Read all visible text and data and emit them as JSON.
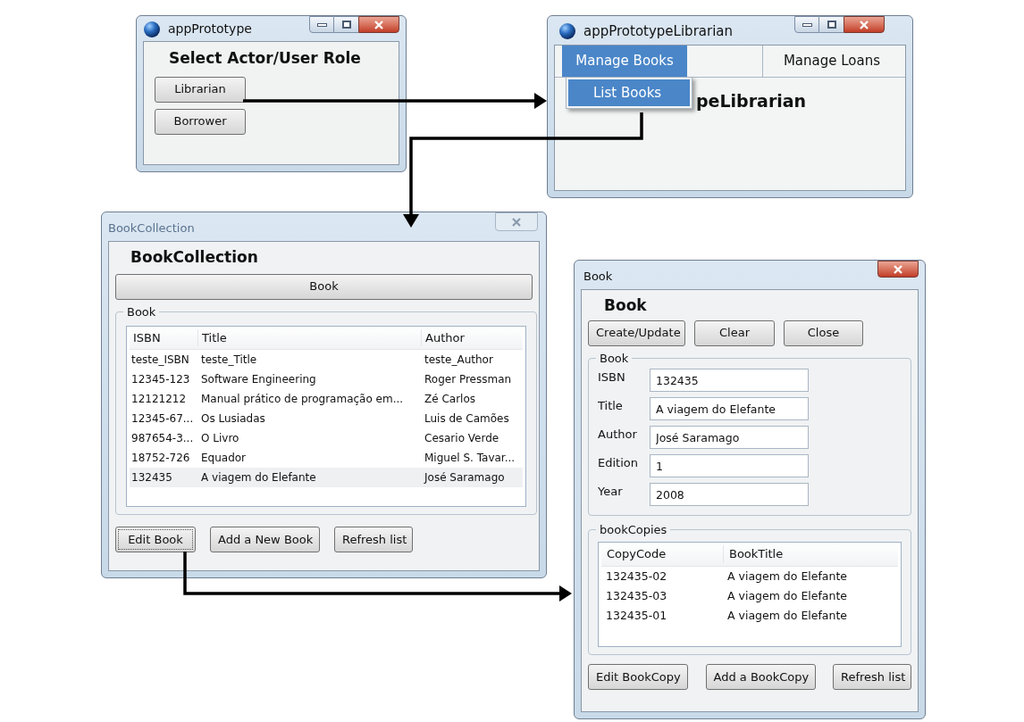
{
  "role_window": {
    "title": "appPrototype",
    "heading": "Select Actor/User Role",
    "buttons": [
      "Librarian",
      "Borrower"
    ]
  },
  "librarian_window": {
    "title": "appPrototypeLibrarian",
    "menus": [
      {
        "label": "Manage Books",
        "selected": true
      },
      {
        "label": "Manage Loans",
        "selected": false
      }
    ],
    "dropdown_items": [
      {
        "label": "List Books",
        "selected": true
      }
    ],
    "heading_visible": "peLibrarian"
  },
  "collection_window": {
    "title": "BookCollection",
    "heading": "BookCollection",
    "top_button": "Book",
    "group_label": "Book",
    "table": {
      "columns": [
        "ISBN",
        "Title",
        "Author"
      ],
      "rows": [
        {
          "cells": [
            "teste_ISBN",
            "teste_Title",
            "teste_Author"
          ],
          "selected": false
        },
        {
          "cells": [
            "12345-123",
            "Software Engineering",
            "Roger Pressman"
          ],
          "selected": false
        },
        {
          "cells": [
            "12121212",
            "Manual prático de programação em...",
            "Zé Carlos"
          ],
          "selected": false
        },
        {
          "cells": [
            "12345-67...",
            "Os Lusiadas",
            "Luis de Camões"
          ],
          "selected": false
        },
        {
          "cells": [
            "987654-3...",
            "O Livro",
            "Cesario Verde"
          ],
          "selected": false
        },
        {
          "cells": [
            "18752-726",
            "Equador",
            "Miguel S. Tavar..."
          ],
          "selected": false
        },
        {
          "cells": [
            "132435",
            "A viagem do Elefante",
            "José Saramago"
          ],
          "selected": true
        }
      ]
    },
    "buttons": [
      "Edit Book",
      "Add a New Book",
      "Refresh list"
    ]
  },
  "book_window": {
    "title": "Book",
    "heading": "Book",
    "buttons": [
      "Create/Update",
      "Clear",
      "Close"
    ],
    "group_label": "Book",
    "fields": [
      {
        "label": "ISBN",
        "value": "132435"
      },
      {
        "label": "Title",
        "value": "A viagem do Elefante"
      },
      {
        "label": "Author",
        "value": "José Saramago"
      },
      {
        "label": "Edition",
        "value": "1"
      },
      {
        "label": "Year",
        "value": "2008"
      }
    ],
    "copies_group_label": "bookCopies",
    "copies_table": {
      "columns": [
        "CopyCode",
        "BookTitle"
      ],
      "rows": [
        {
          "cells": [
            "132435-02",
            "A viagem do Elefante"
          ]
        },
        {
          "cells": [
            "132435-03",
            "A viagem do Elefante"
          ]
        },
        {
          "cells": [
            "132435-01",
            "A viagem do Elefante"
          ]
        }
      ]
    },
    "bottom_buttons": [
      "Edit BookCopy",
      "Add a BookCopy",
      "Refresh list"
    ]
  }
}
